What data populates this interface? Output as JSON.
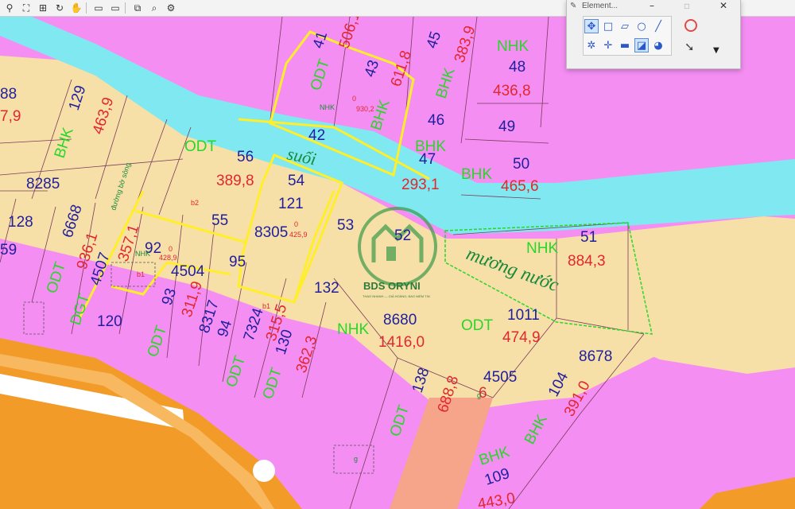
{
  "toolbar": {
    "buttons": [
      {
        "name": "zoom-out-icon",
        "glyph": "⚲"
      },
      {
        "name": "zoom-extents-icon",
        "glyph": "⛶"
      },
      {
        "name": "zoom-window-icon",
        "glyph": "⊞"
      },
      {
        "name": "refresh-icon",
        "glyph": "↻"
      },
      {
        "name": "pan-hand-icon",
        "glyph": "✋"
      },
      {
        "name": "view-previous-icon",
        "glyph": "▭"
      },
      {
        "name": "view-next-icon",
        "glyph": "▭"
      },
      {
        "name": "fit-view-icon",
        "glyph": "⧉"
      },
      {
        "name": "select-zoom-icon",
        "glyph": "⌕"
      },
      {
        "name": "update-view-icon",
        "glyph": "⚙"
      }
    ]
  },
  "panel": {
    "title": "Element...",
    "row1": [
      "✥",
      "□",
      "▱",
      "○",
      "╱"
    ],
    "row2": [
      "✲",
      "✛",
      "▬",
      "◪",
      "◕"
    ]
  },
  "map": {
    "watermark": {
      "brand": "BDS ORYNI",
      "tagline": "THAO NHANH — GIÁ HOÀNG, BAO NIỀM TIN"
    },
    "water_labels": [
      "suối",
      "mương nước"
    ],
    "labels_blue": [
      {
        "id": "p41",
        "t": "41"
      },
      {
        "id": "p43",
        "t": "43"
      },
      {
        "id": "p45",
        "t": "45"
      },
      {
        "id": "p48",
        "t": "48"
      },
      {
        "id": "p42",
        "t": "42"
      },
      {
        "id": "p46",
        "t": "46"
      },
      {
        "id": "p47",
        "t": "47"
      },
      {
        "id": "p49",
        "t": "49"
      },
      {
        "id": "p50",
        "t": "50"
      },
      {
        "id": "p129",
        "t": "129"
      },
      {
        "id": "p56",
        "t": "56"
      },
      {
        "id": "p54",
        "t": "54"
      },
      {
        "id": "p121",
        "t": "121"
      },
      {
        "id": "p8285",
        "t": "8285"
      },
      {
        "id": "p128",
        "t": "128"
      },
      {
        "id": "p6668",
        "t": "6668"
      },
      {
        "id": "p55",
        "t": "55"
      },
      {
        "id": "p8305",
        "t": "8305"
      },
      {
        "id": "p53",
        "t": "53"
      },
      {
        "id": "p52",
        "t": "52"
      },
      {
        "id": "p51",
        "t": "51"
      },
      {
        "id": "p4507",
        "t": "4507"
      },
      {
        "id": "p92",
        "t": "92"
      },
      {
        "id": "p95",
        "t": "95"
      },
      {
        "id": "p4504",
        "t": "4504"
      },
      {
        "id": "p132",
        "t": "132"
      },
      {
        "id": "p93",
        "t": "93"
      },
      {
        "id": "p120",
        "t": "120"
      },
      {
        "id": "p8317",
        "t": "8317"
      },
      {
        "id": "p94",
        "t": "94"
      },
      {
        "id": "p7324",
        "t": "7324"
      },
      {
        "id": "p130",
        "t": "130"
      },
      {
        "id": "p8680",
        "t": "8680"
      },
      {
        "id": "p1011",
        "t": "1011"
      },
      {
        "id": "p8678",
        "t": "8678"
      },
      {
        "id": "p4505",
        "t": "4505"
      },
      {
        "id": "p138",
        "t": "138"
      },
      {
        "id": "p104",
        "t": "104"
      },
      {
        "id": "p109",
        "t": "109"
      },
      {
        "id": "p88",
        "t": "88"
      },
      {
        "id": "p59",
        "t": "59"
      }
    ],
    "labels_red": [
      {
        "id": "a41",
        "t": "506,1"
      },
      {
        "id": "a43",
        "t": "611,8"
      },
      {
        "id": "a45",
        "t": "383,9"
      },
      {
        "id": "a48",
        "t": "436,8"
      },
      {
        "id": "a129",
        "t": "463,9"
      },
      {
        "id": "a56",
        "t": "389,8"
      },
      {
        "id": "a47",
        "t": "293,1"
      },
      {
        "id": "a50",
        "t": "465,6"
      },
      {
        "id": "a6668",
        "t": "936,1"
      },
      {
        "id": "a4507",
        "t": "357,1"
      },
      {
        "id": "a51",
        "t": "884,3"
      },
      {
        "id": "a93",
        "t": "311,9"
      },
      {
        "id": "a7324",
        "t": "315,5"
      },
      {
        "id": "a130",
        "t": "362,3"
      },
      {
        "id": "a8680",
        "t": "1416,0"
      },
      {
        "id": "a1011",
        "t": "474,9"
      },
      {
        "id": "a138",
        "t": "688,8"
      },
      {
        "id": "a104",
        "t": "391,0"
      },
      {
        "id": "a109",
        "t": "443,0"
      },
      {
        "id": "a88",
        "t": "7,9"
      },
      {
        "id": "a4505",
        "t": "6"
      }
    ],
    "labels_green": [
      {
        "id": "g41",
        "t": "ODT"
      },
      {
        "id": "g43",
        "t": "BHK"
      },
      {
        "id": "g45",
        "t": "BHK"
      },
      {
        "id": "g48",
        "t": "NHK"
      },
      {
        "id": "g129",
        "t": "BHK"
      },
      {
        "id": "g56",
        "t": "ODT"
      },
      {
        "id": "g47",
        "t": "BHK"
      },
      {
        "id": "g50",
        "t": "BHK"
      },
      {
        "id": "g6668",
        "t": "ODT"
      },
      {
        "id": "g4507",
        "t": "DGT"
      },
      {
        "id": "g51",
        "t": "NHK"
      },
      {
        "id": "g93",
        "t": "ODT"
      },
      {
        "id": "g7324",
        "t": "ODT"
      },
      {
        "id": "g130",
        "t": "ODT"
      },
      {
        "id": "g8680",
        "t": "NHK"
      },
      {
        "id": "g1011",
        "t": "ODT"
      },
      {
        "id": "g138",
        "t": "ODT"
      },
      {
        "id": "g104",
        "t": "BHK"
      },
      {
        "id": "g109",
        "t": "BHK"
      }
    ],
    "labels_small": [
      {
        "id": "s1",
        "t": "NHK"
      },
      {
        "id": "s2",
        "t": "0"
      },
      {
        "id": "s3",
        "t": "930,2"
      },
      {
        "id": "s4",
        "t": "0"
      },
      {
        "id": "s5",
        "t": "425,9"
      },
      {
        "id": "s6",
        "t": "NHK"
      },
      {
        "id": "s7",
        "t": "0"
      },
      {
        "id": "s8",
        "t": "428,9"
      },
      {
        "id": "s9",
        "t": "b1"
      },
      {
        "id": "s10",
        "t": "b1"
      },
      {
        "id": "s11",
        "t": "g"
      },
      {
        "id": "s12",
        "t": "g"
      },
      {
        "id": "s13",
        "t": "đường bờ sông"
      },
      {
        "id": "s14",
        "t": "b2"
      }
    ]
  }
}
